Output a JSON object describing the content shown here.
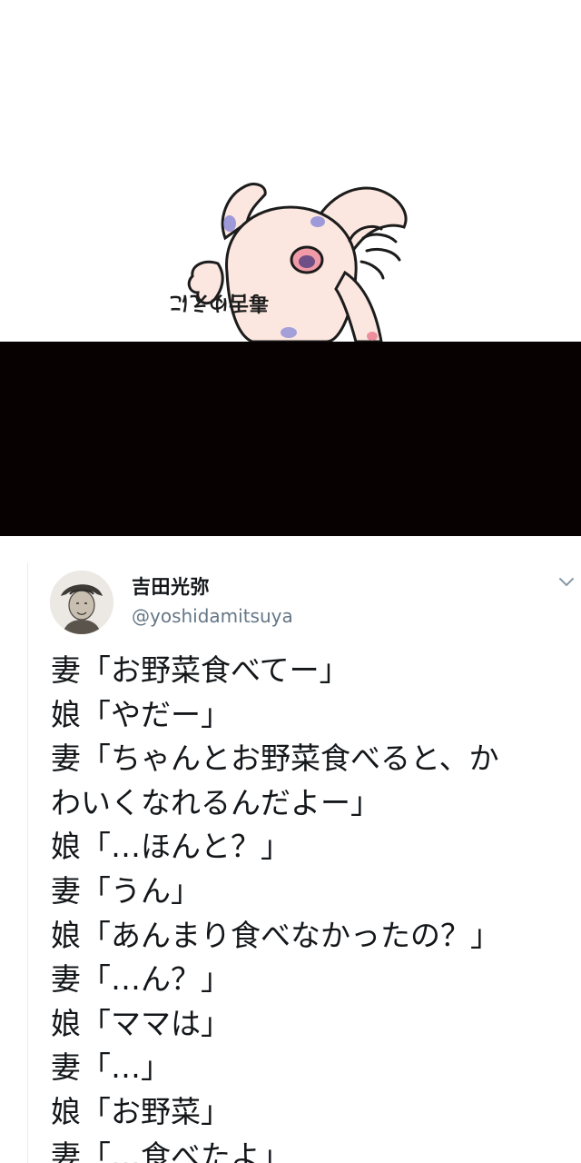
{
  "header": {
    "illustration_icon": "cartoon-character-icon",
    "illustration_text": "毒舌ゆえに"
  },
  "tweet": {
    "avatar_icon": "avatar-portrait-icon",
    "display_name": "吉田光弥",
    "handle": "@yoshidamitsuya",
    "menu_icon": "chevron-down-icon",
    "lines": [
      "妻「お野菜食べてー」",
      "娘「やだー」",
      "妻「ちゃんとお野菜食べると、か",
      "わいくなれるんだよー」",
      "娘「…ほんと？」",
      "妻「うん」",
      "娘「あんまり食べなかったの？」",
      "妻「…ん？」",
      "娘「ママは」",
      "妻「…」",
      "娘「お野菜」",
      "妻「…食べたよ」"
    ]
  },
  "colors": {
    "band": "#070102",
    "name": "#14171a",
    "handle": "#657786"
  }
}
